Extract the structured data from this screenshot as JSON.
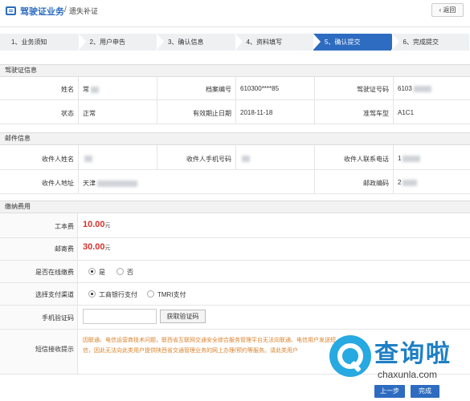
{
  "header": {
    "title": "驾驶证业务",
    "separator": "/",
    "subtitle": "遗失补证",
    "back_label": "返回"
  },
  "steps": [
    {
      "label": "1、业务须知"
    },
    {
      "label": "2、用户申告"
    },
    {
      "label": "3、确认信息"
    },
    {
      "label": "4、资料填写"
    },
    {
      "label": "5、确认提交"
    },
    {
      "label": "6、完成提交"
    }
  ],
  "license_section": {
    "title": "驾驶证信息",
    "name_label": "姓名",
    "name_value": "常",
    "file_no_label": "档案编号",
    "file_no_value": "610300****85",
    "license_no_label": "驾驶证号码",
    "license_no_value": "6103",
    "status_label": "状态",
    "status_value": "正常",
    "expire_label": "有效期止日期",
    "expire_value": "2018-11-18",
    "vehicle_label": "准驾车型",
    "vehicle_value": "A1C1"
  },
  "mail_section": {
    "title": "邮件信息",
    "receiver_label": "收件人姓名",
    "phone_label": "收件人手机号码",
    "contact_label": "收件人联系电话",
    "contact_value": "1",
    "address_label": "收件人地址",
    "address_value": "天津",
    "postcode_label": "邮政编码",
    "postcode_value": "2"
  },
  "fee_section": {
    "title": "缴纳费用",
    "cost_label": "工本费",
    "cost_value": "10.00",
    "cost_unit": "元",
    "postage_label": "邮寄费",
    "postage_value": "30.00",
    "postage_unit": "元",
    "online_label": "是否在线缴费",
    "online_yes": "是",
    "online_no": "否",
    "channel_label": "选择支付渠道",
    "channel_icbc": "工商银行支付",
    "channel_tmri": "TMRI支付",
    "code_label": "手机验证码",
    "code_button": "获取验证码",
    "sms_label": "短信接收提示",
    "sms_text": "因联通、电信运营商技术问题，联西省互联网交通安全综合服务管理平台无法向联通、电信用户发送短信，因此无法向此类用户提供陕西省交通管理业务的网上办理/预约等服务。请此类用户"
  },
  "footer": {
    "prev_label": "上一步",
    "finish_label": "完成"
  },
  "watermark": {
    "brand": "查询啦",
    "url": "chaxunla.com"
  },
  "colors": {
    "accent": "#2d6cc0",
    "fee": "#d9322c",
    "notice": "#d9822b"
  },
  "icons": {
    "app": "id-card-icon",
    "back": "chevron-left-icon",
    "wm": "magnifier-icon"
  }
}
